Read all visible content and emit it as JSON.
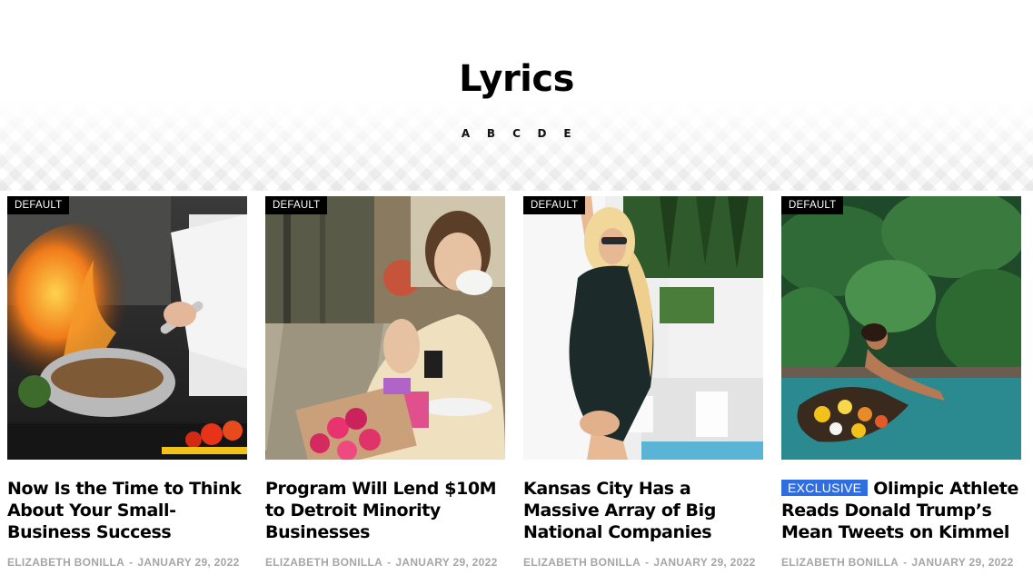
{
  "page": {
    "title": "Lyrics",
    "letters": [
      "A",
      "B",
      "C",
      "D",
      "E"
    ]
  },
  "posts": [
    {
      "category": "DEFAULT",
      "image_icon": "chef-flambe-image",
      "exclusive": "",
      "title": "Now Is the Time to Think About Your Small-Business Success",
      "author": "ELIZABETH BONILLA",
      "separator": "-",
      "date": "JANUARY 29, 2022"
    },
    {
      "category": "DEFAULT",
      "image_icon": "woman-coffee-image",
      "exclusive": "",
      "title": "Program Will Lend $10M to Detroit Minority Businesses",
      "author": "ELIZABETH BONILLA",
      "separator": "-",
      "date": "JANUARY 29, 2022"
    },
    {
      "category": "DEFAULT",
      "image_icon": "swimsuit-pool-image",
      "exclusive": "",
      "title": "Kansas City Has a Massive Array of Big National Companies",
      "author": "ELIZABETH BONILLA",
      "separator": "-",
      "date": "JANUARY 29, 2022"
    },
    {
      "category": "DEFAULT",
      "image_icon": "pool-breakfast-image",
      "exclusive": "EXCLUSIVE",
      "title": "Olimpic Athlete Reads Donald Trump’s Mean Tweets on Kimmel",
      "author": "ELIZABETH BONILLA",
      "separator": "-",
      "date": "JANUARY 29, 2022"
    }
  ],
  "colors": {
    "exclusive_badge": "#2f6ee0",
    "category_badge": "#000000",
    "meta_text": "#a6a6a6"
  }
}
